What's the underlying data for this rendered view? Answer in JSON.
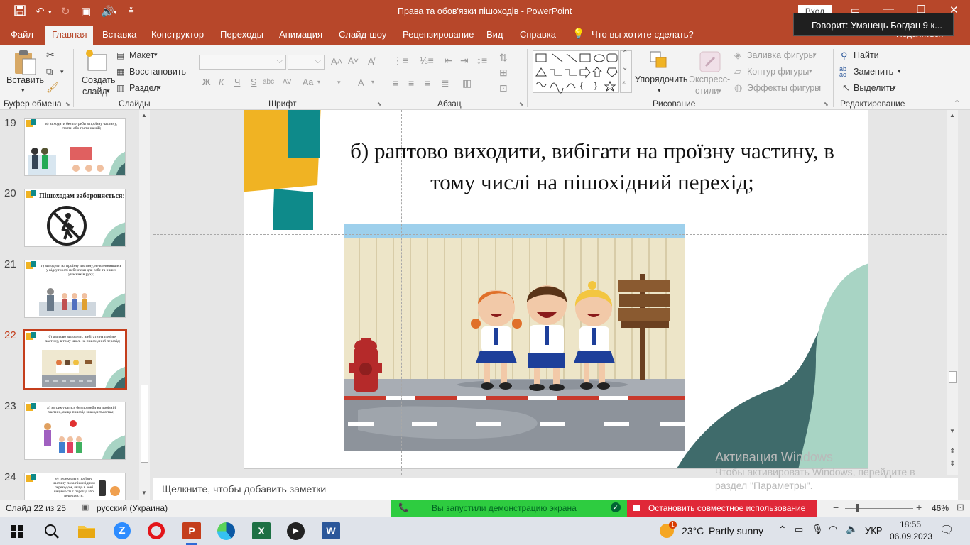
{
  "window": {
    "title": "Права та обов'язки пішоходів  -  PowerPoint",
    "login_button": "Вход"
  },
  "speaking": {
    "text": "Говорит: Уманець Богдан 9 к..."
  },
  "share": {
    "label": "Поделиться"
  },
  "tabs": [
    "Файл",
    "Главная",
    "Вставка",
    "Конструктор",
    "Переходы",
    "Анимация",
    "Слайд-шоу",
    "Рецензирование",
    "Вид",
    "Справка",
    "Что вы хотите сделать?"
  ],
  "ribbon": {
    "clipboard": {
      "paste": "Вставить",
      "group": "Буфер обмена"
    },
    "slides": {
      "new_slide_line1": "Создать",
      "new_slide_line2": "слайд",
      "layout": "Макет",
      "reset": "Восстановить",
      "section": "Раздел",
      "group": "Слайды"
    },
    "font": {
      "group": "Шрифт",
      "bold": "Ж",
      "italic": "К",
      "underline": "Ч",
      "shadow": "S",
      "strike": "abc",
      "spacing": "AV",
      "case": "Aa",
      "color": "A"
    },
    "paragraph": {
      "group": "Абзац"
    },
    "drawing": {
      "arrange": "Упорядочить",
      "quick_styles_line1": "Экспресс-",
      "quick_styles_line2": "стили",
      "fill": "Заливка фигуры",
      "outline": "Контур фигуры",
      "effects": "Эффекты фигуры",
      "group": "Рисование"
    },
    "editing": {
      "find": "Найти",
      "replace": "Заменить",
      "select": "Выделить",
      "group": "Редактирование"
    }
  },
  "thumbnails": [
    {
      "num": "19",
      "text": "в) виходити без потреби в проїзну частину, стояти або грати на ній;"
    },
    {
      "num": "20",
      "text": "Пішоходам забороняється:"
    },
    {
      "num": "21",
      "text": "г) виходити на проїзну частину, не впевнившись у відсутності небезпеки для себе та інших учасників руху;"
    },
    {
      "num": "22",
      "text": "б) раптово виходити, вибігати на проїзну частину, в тому числі на пішохідний перехід;"
    },
    {
      "num": "23",
      "text": "д) затримуватися без потреби на проїзній частині, якщо пішохід знаходиться там;"
    },
    {
      "num": "24",
      "text": "е) переходити проїзну частину поза пішохідним переходом, якщо в зоні видимості є перехід або перехрестя;"
    }
  ],
  "slide": {
    "text": "б) раптово виходити, вибігати на проїзну частину, в тому числі на пішохідний перехід;"
  },
  "notes": {
    "placeholder": "Щелкните, чтобы добавить заметки"
  },
  "activation": {
    "line1": "Активация Windows",
    "line2": "Чтобы активировать Windows, перейдите в",
    "line3": "раздел \"Параметры\"."
  },
  "status": {
    "slide": "Слайд 22 из 25",
    "language": "русский (Украина)",
    "screen_share": "Вы запустили демонстрацию экрана",
    "stop_share": "Остановить совместное использование",
    "zoom": "46%"
  },
  "taskbar": {
    "temperature": "23°C",
    "weather": "Partly sunny",
    "lang": "УКР",
    "time": "18:55",
    "date": "06.09.2023",
    "notif_badge": "1"
  },
  "colors": {
    "accent": "#b7472a",
    "teal": "#0e8a8a",
    "yellow": "#f0b323",
    "share_green": "#2ecc40",
    "stop_red": "#e02838"
  }
}
